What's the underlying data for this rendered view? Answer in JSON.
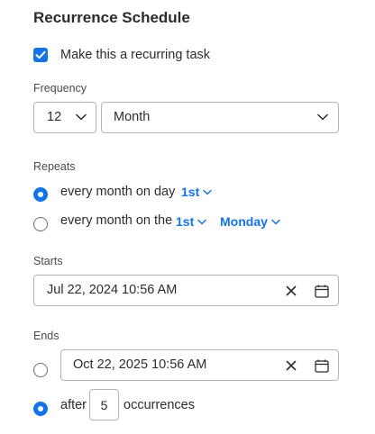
{
  "title": "Recurrence Schedule",
  "recurring": {
    "label": "Make this a recurring task",
    "checked": true
  },
  "frequency": {
    "label": "Frequency",
    "interval": "12",
    "unit": "Month"
  },
  "repeats": {
    "label": "Repeats",
    "option1": {
      "text": "every month on day",
      "day": "1st",
      "selected": true
    },
    "option2": {
      "text": "every month on the",
      "ordinal": "1st",
      "weekday": "Monday",
      "selected": false
    }
  },
  "starts": {
    "label": "Starts",
    "value": "Jul 22, 2024 10:56 AM"
  },
  "ends": {
    "label": "Ends",
    "on_date": {
      "value": "Oct 22, 2025 10:56 AM",
      "selected": false
    },
    "after": {
      "prefix": "after",
      "count": "5",
      "suffix": "occurrences",
      "selected": true
    }
  },
  "colors": {
    "accent": "#1473e6",
    "text": "#2c2c2c",
    "border": "#b5b5b5"
  }
}
